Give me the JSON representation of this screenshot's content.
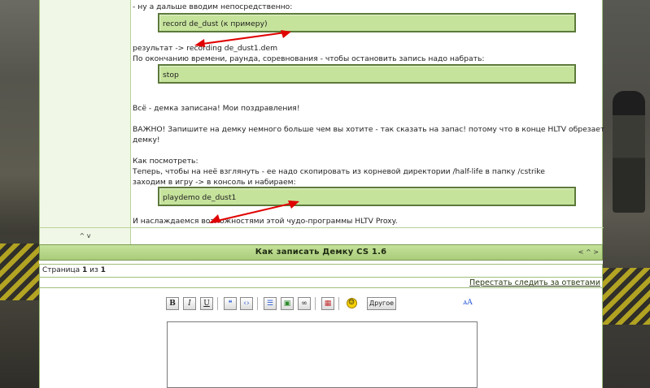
{
  "post": {
    "lines": {
      "intro": "- ну а дальше вводим непосредственно:",
      "result": "результат -> recording de_dust1.dem",
      "stop_hint": "По окончанию времени, раунда, соревнования - чтобы остановить запись надо набрать:",
      "done": "Всё - демка записана! Мои поздравления!",
      "important1": "ВАЖНО! Запишите на демку немного больше чем вы хотите - так сказать на запас! потому что в конце HLTV обрезает",
      "important2": "демку!",
      "howto": "Как посмотреть:",
      "howto2": "Теперь, чтобы на неё взглянуть - ее надо скопировать из корневой директории /half-life в папку /cstrike",
      "howto3": "заходим в игру -> в консоль и набираем:",
      "enjoy": "И наслаждаемся возможностями этой чудо-программы HLTV Proxy."
    },
    "code": {
      "record": "record de_dust (к примеру)",
      "stop": "stop",
      "play": "playdemo de_dust1"
    },
    "arrow_color": "#e00000",
    "updown": "^ v"
  },
  "topic": {
    "title": "Как записать Демку CS 1.6",
    "nav": "< ^ >"
  },
  "pagination": {
    "prefix": "Страница ",
    "current": "1",
    "middle": " из ",
    "total": "1"
  },
  "unsubscribe": "Перестать следить за ответами",
  "toolbar": {
    "bold": "B",
    "italic": "I",
    "underline": "U",
    "other": "Другое"
  },
  "colors": {
    "accent": "#a9cc7a",
    "code_bg": "#c6e39c",
    "code_border": "#5c7a3a"
  }
}
